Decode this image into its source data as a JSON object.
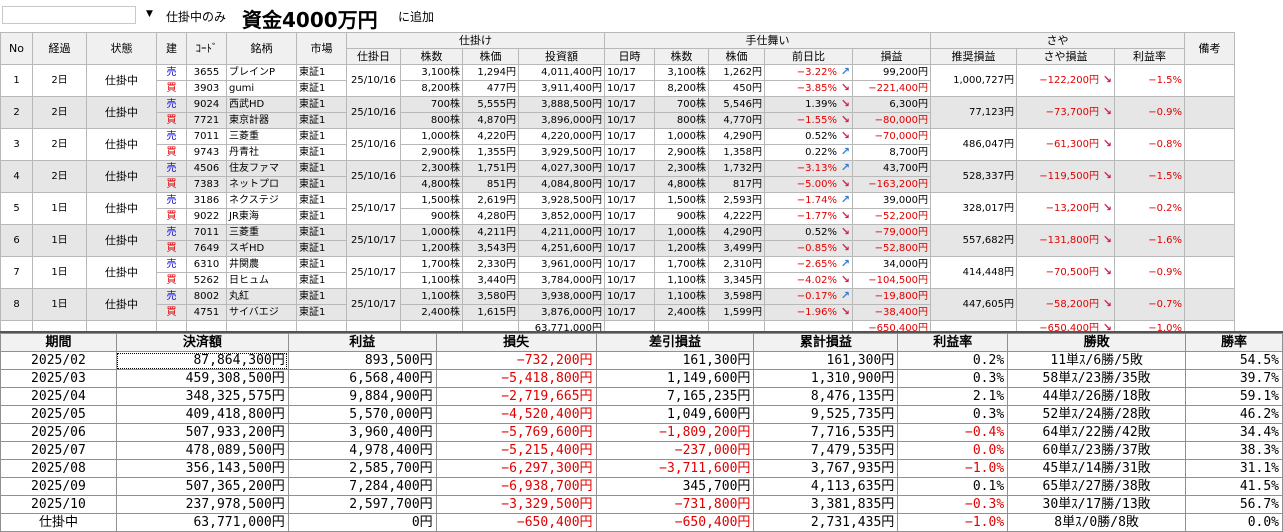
{
  "toolbar": {
    "dropdown_icon": "caret-down-icon",
    "filter_label": "仕掛中のみ",
    "title": "資金4000万円",
    "add_label": "に追加"
  },
  "colors": {
    "sell": "#0000dd",
    "buy": "#dd0000",
    "negative": "#e00000",
    "up_arrow": "#2d7cd6",
    "down_arrow": "#d81c48",
    "row_shade": "#e6e6e6"
  },
  "headers": {
    "no": "No",
    "elapsed": "経過",
    "status": "状態",
    "side": "建",
    "code": "ｺｰﾄﾞ",
    "name": "銘柄",
    "market": "市場",
    "entry_group": "仕掛け",
    "entry_date": "仕掛日",
    "entry_shares": "株数",
    "entry_price": "株価",
    "investment": "投資額",
    "exit_group": "手仕舞い",
    "exit_date": "日時",
    "exit_shares": "株数",
    "exit_price": "株価",
    "day_change": "前日比",
    "pnl": "損益",
    "spread_group": "さや",
    "recommended_pnl": "推奨損益",
    "spread_pnl": "さや損益",
    "profit_rate": "利益率",
    "notes": "備考"
  },
  "positions": [
    {
      "no": "1",
      "elapsed": "2日",
      "status": "仕掛中",
      "entry_date": "25/10/16",
      "recommended_pnl": "1,000,727円",
      "spread_pnl": "−122,200円",
      "spread_arrow": "down",
      "profit_rate": "−1.5%",
      "legs": [
        {
          "side": "売",
          "code": "3655",
          "name": "ブレインP",
          "market": "東証1",
          "shares": "3,100株",
          "price": "1,294円",
          "investment": "4,011,400円",
          "exit_date": "10/17",
          "exit_shares": "3,100株",
          "exit_price": "1,262円",
          "change": "−3.22%",
          "arrow": "up",
          "pnl": "99,200円"
        },
        {
          "side": "買",
          "code": "3903",
          "name": "gumi",
          "market": "東証1",
          "shares": "8,200株",
          "price": "477円",
          "investment": "3,911,400円",
          "exit_date": "10/17",
          "exit_shares": "8,200株",
          "exit_price": "450円",
          "change": "−3.85%",
          "arrow": "down",
          "pnl": "−221,400円"
        }
      ]
    },
    {
      "no": "2",
      "elapsed": "2日",
      "status": "仕掛中",
      "entry_date": "25/10/16",
      "recommended_pnl": "77,123円",
      "spread_pnl": "−73,700円",
      "spread_arrow": "down",
      "profit_rate": "−0.9%",
      "legs": [
        {
          "side": "売",
          "code": "9024",
          "name": "西武HD",
          "market": "東証1",
          "shares": "700株",
          "price": "5,555円",
          "investment": "3,888,500円",
          "exit_date": "10/17",
          "exit_shares": "700株",
          "exit_price": "5,546円",
          "change": "1.39%",
          "arrow": "down",
          "pnl": "6,300円"
        },
        {
          "side": "買",
          "code": "7721",
          "name": "東京計器",
          "market": "東証1",
          "shares": "800株",
          "price": "4,870円",
          "investment": "3,896,000円",
          "exit_date": "10/17",
          "exit_shares": "800株",
          "exit_price": "4,770円",
          "change": "−1.55%",
          "arrow": "down",
          "pnl": "−80,000円"
        }
      ]
    },
    {
      "no": "3",
      "elapsed": "2日",
      "status": "仕掛中",
      "entry_date": "25/10/16",
      "recommended_pnl": "486,047円",
      "spread_pnl": "−61,300円",
      "spread_arrow": "down",
      "profit_rate": "−0.8%",
      "legs": [
        {
          "side": "売",
          "code": "7011",
          "name": "三菱重",
          "market": "東証1",
          "shares": "1,000株",
          "price": "4,220円",
          "investment": "4,220,000円",
          "exit_date": "10/17",
          "exit_shares": "1,000株",
          "exit_price": "4,290円",
          "change": "0.52%",
          "arrow": "down",
          "pnl": "−70,000円"
        },
        {
          "side": "買",
          "code": "9743",
          "name": "丹青社",
          "market": "東証1",
          "shares": "2,900株",
          "price": "1,355円",
          "investment": "3,929,500円",
          "exit_date": "10/17",
          "exit_shares": "2,900株",
          "exit_price": "1,358円",
          "change": "0.22%",
          "arrow": "up",
          "pnl": "8,700円"
        }
      ]
    },
    {
      "no": "4",
      "elapsed": "2日",
      "status": "仕掛中",
      "entry_date": "25/10/16",
      "recommended_pnl": "528,337円",
      "spread_pnl": "−119,500円",
      "spread_arrow": "down",
      "profit_rate": "−1.5%",
      "legs": [
        {
          "side": "売",
          "code": "4506",
          "name": "住友ファマ",
          "market": "東証1",
          "shares": "2,300株",
          "price": "1,751円",
          "investment": "4,027,300円",
          "exit_date": "10/17",
          "exit_shares": "2,300株",
          "exit_price": "1,732円",
          "change": "−3.13%",
          "arrow": "up",
          "pnl": "43,700円"
        },
        {
          "side": "買",
          "code": "7383",
          "name": "ネットプロ",
          "market": "東証1",
          "shares": "4,800株",
          "price": "851円",
          "investment": "4,084,800円",
          "exit_date": "10/17",
          "exit_shares": "4,800株",
          "exit_price": "817円",
          "change": "−5.00%",
          "arrow": "down",
          "pnl": "−163,200円"
        }
      ]
    },
    {
      "no": "5",
      "elapsed": "1日",
      "status": "仕掛中",
      "entry_date": "25/10/17",
      "recommended_pnl": "328,017円",
      "spread_pnl": "−13,200円",
      "spread_arrow": "down",
      "profit_rate": "−0.2%",
      "legs": [
        {
          "side": "売",
          "code": "3186",
          "name": "ネクステジ",
          "market": "東証1",
          "shares": "1,500株",
          "price": "2,619円",
          "investment": "3,928,500円",
          "exit_date": "10/17",
          "exit_shares": "1,500株",
          "exit_price": "2,593円",
          "change": "−1.74%",
          "arrow": "up",
          "pnl": "39,000円"
        },
        {
          "side": "買",
          "code": "9022",
          "name": "JR東海",
          "market": "東証1",
          "shares": "900株",
          "price": "4,280円",
          "investment": "3,852,000円",
          "exit_date": "10/17",
          "exit_shares": "900株",
          "exit_price": "4,222円",
          "change": "−1.77%",
          "arrow": "down",
          "pnl": "−52,200円"
        }
      ]
    },
    {
      "no": "6",
      "elapsed": "1日",
      "status": "仕掛中",
      "entry_date": "25/10/17",
      "recommended_pnl": "557,682円",
      "spread_pnl": "−131,800円",
      "spread_arrow": "down",
      "profit_rate": "−1.6%",
      "legs": [
        {
          "side": "売",
          "code": "7011",
          "name": "三菱重",
          "market": "東証1",
          "shares": "1,000株",
          "price": "4,211円",
          "investment": "4,211,000円",
          "exit_date": "10/17",
          "exit_shares": "1,000株",
          "exit_price": "4,290円",
          "change": "0.52%",
          "arrow": "down",
          "pnl": "−79,000円"
        },
        {
          "side": "買",
          "code": "7649",
          "name": "スギHD",
          "market": "東証1",
          "shares": "1,200株",
          "price": "3,543円",
          "investment": "4,251,600円",
          "exit_date": "10/17",
          "exit_shares": "1,200株",
          "exit_price": "3,499円",
          "change": "−0.85%",
          "arrow": "down",
          "pnl": "−52,800円"
        }
      ]
    },
    {
      "no": "7",
      "elapsed": "1日",
      "status": "仕掛中",
      "entry_date": "25/10/17",
      "recommended_pnl": "414,448円",
      "spread_pnl": "−70,500円",
      "spread_arrow": "down",
      "profit_rate": "−0.9%",
      "legs": [
        {
          "side": "売",
          "code": "6310",
          "name": "井関農",
          "market": "東証1",
          "shares": "1,700株",
          "price": "2,330円",
          "investment": "3,961,000円",
          "exit_date": "10/17",
          "exit_shares": "1,700株",
          "exit_price": "2,310円",
          "change": "−2.65%",
          "arrow": "up",
          "pnl": "34,000円"
        },
        {
          "side": "買",
          "code": "5262",
          "name": "日ヒュム",
          "market": "東証1",
          "shares": "1,100株",
          "price": "3,440円",
          "investment": "3,784,000円",
          "exit_date": "10/17",
          "exit_shares": "1,100株",
          "exit_price": "3,345円",
          "change": "−4.02%",
          "arrow": "down",
          "pnl": "−104,500円"
        }
      ]
    },
    {
      "no": "8",
      "elapsed": "1日",
      "status": "仕掛中",
      "entry_date": "25/10/17",
      "recommended_pnl": "447,605円",
      "spread_pnl": "−58,200円",
      "spread_arrow": "down",
      "profit_rate": "−0.7%",
      "legs": [
        {
          "side": "売",
          "code": "8002",
          "name": "丸紅",
          "market": "東証1",
          "shares": "1,100株",
          "price": "3,580円",
          "investment": "3,938,000円",
          "exit_date": "10/17",
          "exit_shares": "1,100株",
          "exit_price": "3,598円",
          "change": "−0.17%",
          "arrow": "up",
          "pnl": "−19,800円"
        },
        {
          "side": "買",
          "code": "4751",
          "name": "サイバエジ",
          "market": "東証1",
          "shares": "2,400株",
          "price": "1,615円",
          "investment": "3,876,000円",
          "exit_date": "10/17",
          "exit_shares": "2,400株",
          "exit_price": "1,599円",
          "change": "−1.96%",
          "arrow": "down",
          "pnl": "−38,400円"
        }
      ]
    }
  ],
  "totals": {
    "investment": "63,771,000円",
    "pnl": "−650,400円",
    "spread_pnl": "−650,400円",
    "profit_rate": "−1.0%",
    "spread_arrow": "down"
  },
  "summary": {
    "headers": [
      "期間",
      "決済額",
      "利益",
      "損失",
      "差引損益",
      "累計損益",
      "利益率",
      "勝敗",
      "勝率"
    ],
    "rows": [
      {
        "period": "2025/02",
        "settled": "87,864,300円",
        "profit": "893,500円",
        "loss": "−732,200円",
        "net": "161,300円",
        "cumulative": "161,300円",
        "rate": "0.2%",
        "record": "11単ｽ/6勝/5敗",
        "win_rate": "54.5%"
      },
      {
        "period": "2025/03",
        "settled": "459,308,500円",
        "profit": "6,568,400円",
        "loss": "−5,418,800円",
        "net": "1,149,600円",
        "cumulative": "1,310,900円",
        "rate": "0.3%",
        "record": "58単ｽ/23勝/35敗",
        "win_rate": "39.7%"
      },
      {
        "period": "2025/04",
        "settled": "348,325,575円",
        "profit": "9,884,900円",
        "loss": "−2,719,665円",
        "net": "7,165,235円",
        "cumulative": "8,476,135円",
        "rate": "2.1%",
        "record": "44単ｽ/26勝/18敗",
        "win_rate": "59.1%"
      },
      {
        "period": "2025/05",
        "settled": "409,418,800円",
        "profit": "5,570,000円",
        "loss": "−4,520,400円",
        "net": "1,049,600円",
        "cumulative": "9,525,735円",
        "rate": "0.3%",
        "record": "52単ｽ/24勝/28敗",
        "win_rate": "46.2%"
      },
      {
        "period": "2025/06",
        "settled": "507,933,200円",
        "profit": "3,960,400円",
        "loss": "−5,769,600円",
        "net": "−1,809,200円",
        "cumulative": "7,716,535円",
        "rate": "−0.4%",
        "record": "64単ｽ/22勝/42敗",
        "win_rate": "34.4%"
      },
      {
        "period": "2025/07",
        "settled": "478,089,500円",
        "profit": "4,978,400円",
        "loss": "−5,215,400円",
        "net": "−237,000円",
        "cumulative": "7,479,535円",
        "rate": "0.0%",
        "record": "60単ｽ/23勝/37敗",
        "win_rate": "38.3%"
      },
      {
        "period": "2025/08",
        "settled": "356,143,500円",
        "profit": "2,585,700円",
        "loss": "−6,297,300円",
        "net": "−3,711,600円",
        "cumulative": "3,767,935円",
        "rate": "−1.0%",
        "record": "45単ｽ/14勝/31敗",
        "win_rate": "31.1%"
      },
      {
        "period": "2025/09",
        "settled": "507,365,200円",
        "profit": "7,284,400円",
        "loss": "−6,938,700円",
        "net": "345,700円",
        "cumulative": "4,113,635円",
        "rate": "0.1%",
        "record": "65単ｽ/27勝/38敗",
        "win_rate": "41.5%"
      },
      {
        "period": "2025/10",
        "settled": "237,978,500円",
        "profit": "2,597,700円",
        "loss": "−3,329,500円",
        "net": "−731,800円",
        "cumulative": "3,381,835円",
        "rate": "−0.3%",
        "record": "30単ｽ/17勝/13敗",
        "win_rate": "56.7%"
      },
      {
        "period": "仕掛中",
        "settled": "63,771,000円",
        "profit": "0円",
        "loss": "−650,400円",
        "net": "−650,400円",
        "cumulative": "2,731,435円",
        "rate": "−1.0%",
        "record": "8単ｽ/0勝/8敗",
        "win_rate": "0.0%"
      }
    ]
  }
}
